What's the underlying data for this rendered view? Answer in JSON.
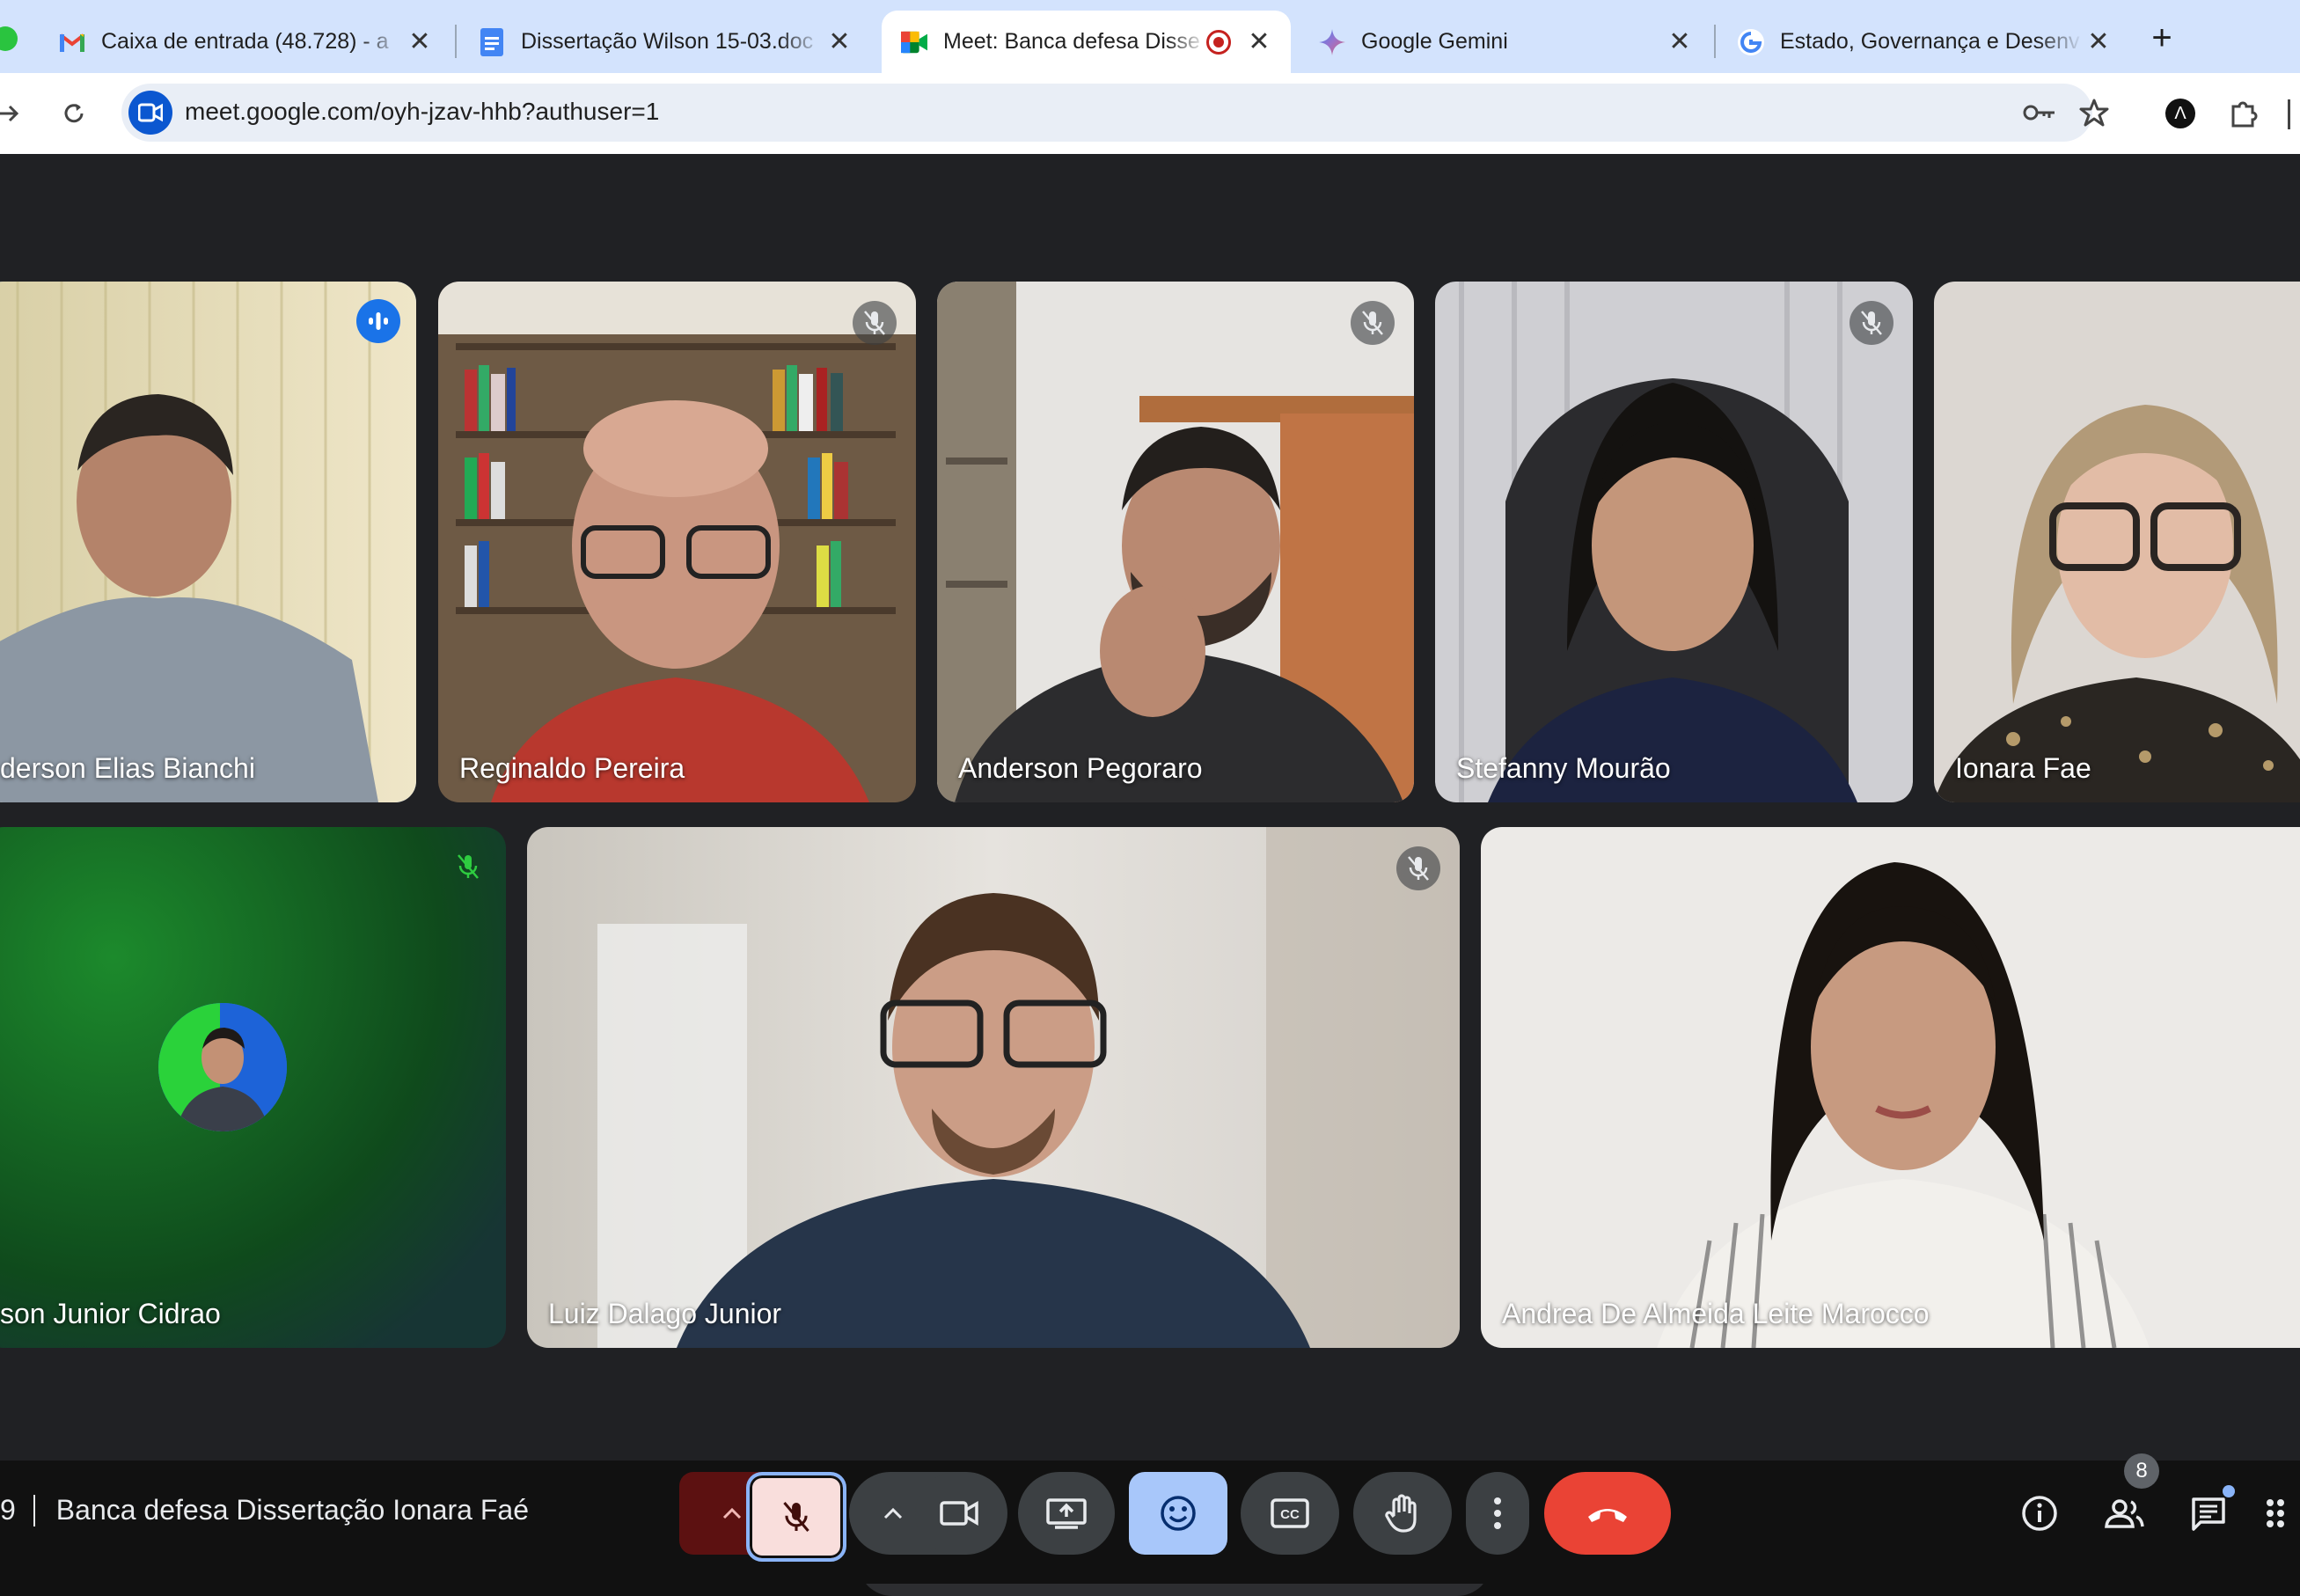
{
  "tabs": [
    {
      "title": "Caixa de entrada (48.728) - a",
      "icon": "gmail-icon"
    },
    {
      "title": "Dissertação Wilson 15-03.doc",
      "icon": "google-docs-icon"
    },
    {
      "title": "Meet: Banca defesa Disse",
      "icon": "google-meet-icon"
    },
    {
      "title": "Google Gemini",
      "icon": "gemini-icon"
    },
    {
      "title": "Estado, Governança e Desenv",
      "icon": "google-icon"
    }
  ],
  "new_tab": "+",
  "address": {
    "url": "meet.google.com/oyh-jzav-hhb?authuser=1"
  },
  "participants_top": [
    {
      "name": "derson Elias Bianchi"
    },
    {
      "name": "Reginaldo Pereira"
    },
    {
      "name": "Anderson Pegoraro"
    },
    {
      "name": "Stefanny Mourão"
    },
    {
      "name": "Ionara Fae"
    }
  ],
  "participants_bottom": [
    {
      "name": "son Junior Cidrao"
    },
    {
      "name": "Luiz Dalago Junior"
    },
    {
      "name": "Andrea De Almeida Leite Marocco"
    }
  ],
  "reactions": [
    "💖",
    "👍",
    "🎉",
    "👏",
    "😂",
    "😮",
    "😢",
    "🤔",
    "👎"
  ],
  "meeting": {
    "time_fragment": "9",
    "title": "Banca defesa Dissertação Ionara Faé"
  },
  "participant_count": "8",
  "colors": {
    "accent": "#a8c7fa",
    "end_call": "#ea4335",
    "mic_off": "#f9dedc",
    "reactions_active": "#a8c7fa"
  }
}
